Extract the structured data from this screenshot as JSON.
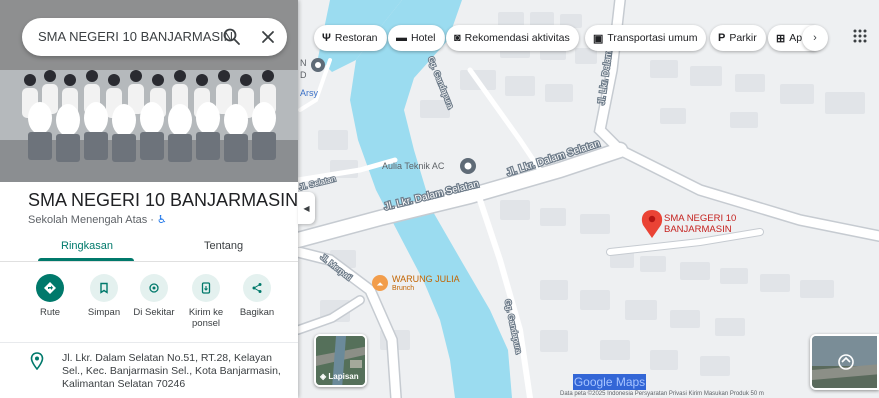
{
  "search": {
    "query": "SMA NEGERI 10 BANJARMASIN"
  },
  "place": {
    "name": "SMA NEGERI 10 BANJARMASIN",
    "category": "Sekolah Menengah Atas · ",
    "accessibility_icon": "wheelchair-icon",
    "address": "Jl. Lkr. Dalam Selatan No.51, RT.28, Kelayan Sel., Kec. Banjarmasin Sel., Kota Banjarmasin, Kalimantan Selatan 70246"
  },
  "tabs": [
    "Ringkasan",
    "Tentang"
  ],
  "actions": [
    {
      "label": "Rute",
      "icon": "directions-icon"
    },
    {
      "label": "Simpan",
      "icon": "bookmark-icon"
    },
    {
      "label": "Di Sekitar",
      "icon": "nearby-icon"
    },
    {
      "label": "Kirim ke ponsel",
      "icon": "send-to-phone-icon"
    },
    {
      "label": "Bagikan",
      "icon": "share-icon"
    }
  ],
  "chips": [
    {
      "label": "Restoran",
      "icon": "restaurant-icon"
    },
    {
      "label": "Hotel",
      "icon": "hotel-icon"
    },
    {
      "label": "Rekomendasi aktivitas",
      "icon": "camera-icon"
    },
    {
      "label": "Transportasi umum",
      "icon": "transit-icon"
    },
    {
      "label": "Parkir",
      "icon": "parking-icon"
    },
    {
      "label": "Ap",
      "icon": "pharmacy-icon"
    }
  ],
  "map": {
    "place_label": "SMA NEGERI 10\nBANJARMASIN",
    "labels": {
      "aulia": "Aulia Teknik AC",
      "warung": "WARUNG JULIA",
      "warung_sub": "Brunch",
      "road_main": "Jl. Lkr. Dalam Selatan",
      "road_main2": "Jl. Lkr. Dalam Selatan",
      "road_north": "Jl. Lkr. Dalam",
      "road_gg": "Gg. Gandapura",
      "road_gg2": "Gg. Gandapura",
      "road_merpati": "Jl. Merpati",
      "road_selatan": "Jl. Selatan",
      "arsy": "Arsy",
      "left_n": "N",
      "left_d": "D"
    },
    "layers_label": "Lapisan",
    "logo_text": "Google Maps",
    "footer_text": "Data peta ©2025   Indonesia   Persyaratan   Privasi   Kirim Masukan Produk   50 m"
  },
  "colors": {
    "accent": "#00796b",
    "water": "#9bdcf0",
    "road": "#ffffff",
    "block": "#e3e6e9",
    "pin": "#ea4335"
  }
}
